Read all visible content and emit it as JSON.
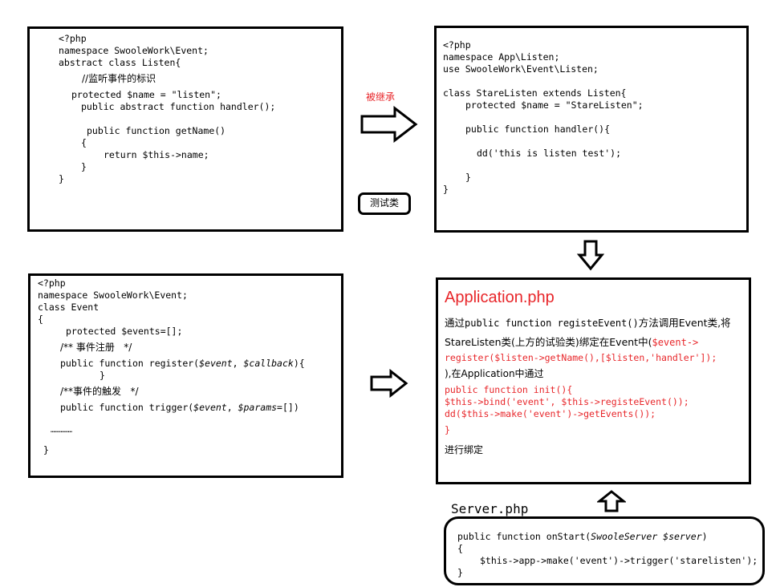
{
  "listen_box": {
    "lines": [
      "<?php",
      "namespace SwooleWork\\Event;",
      "abstract class Listen{",
      "//监听事件的标识",
      "protected $name = \"listen\";",
      "public abstract function handler();",
      "public function getName()",
      "{",
      "return $this->name;",
      "}",
      "}"
    ]
  },
  "inherit_label": "被继承",
  "test_label": "测试类",
  "stare_box": {
    "lines": [
      "<?php",
      "namespace App\\Listen;",
      "use SwooleWork\\Event\\Listen;",
      "class StareListen extends Listen{",
      "protected $name = \"StareListen\";",
      "public function handler(){",
      "dd('this is listen test');",
      "}",
      "}"
    ]
  },
  "event_box": {
    "lines": [
      "<?php",
      "namespace SwooleWork\\Event;",
      "class Event",
      "{",
      "protected $events=[];",
      "/** 事件注册   */",
      "public function register(",
      "$event",
      ", ",
      "$callback",
      "){",
      "}",
      "/**事件的触发   */",
      "public function trigger(",
      "$params",
      "=[])",
      "……………",
      "}"
    ]
  },
  "app_box": {
    "title": "Application.php",
    "desc1_a": "通过",
    "desc1_b": "public function registeEvent()",
    "desc1_c": "方法调用Event类,将",
    "desc2_a": "StareListen类(上方的试验类)绑定在Event中(",
    "desc2_b": "$event->",
    "code_register": "register($listen->getName(),[$listen,'handler']);",
    "desc3": "),在Application中通过",
    "code_init": "public function init(){",
    "code_bind": "$this->bind('event', $this->registeEvent());",
    "code_dd": "dd($this->make('event')->getEvents());",
    "code_close": "}",
    "desc4": "进行绑定"
  },
  "server_box": {
    "title": "Server.php",
    "line1_a": "public function onStart(",
    "line1_b": "SwooleServer $server",
    "line1_c": ")",
    "line2": "{",
    "line3": "$this->app->make('event')->trigger('starelisten');",
    "line4": "}"
  },
  "colors": {
    "accent_red": "#e8262a",
    "border": "#000000"
  }
}
